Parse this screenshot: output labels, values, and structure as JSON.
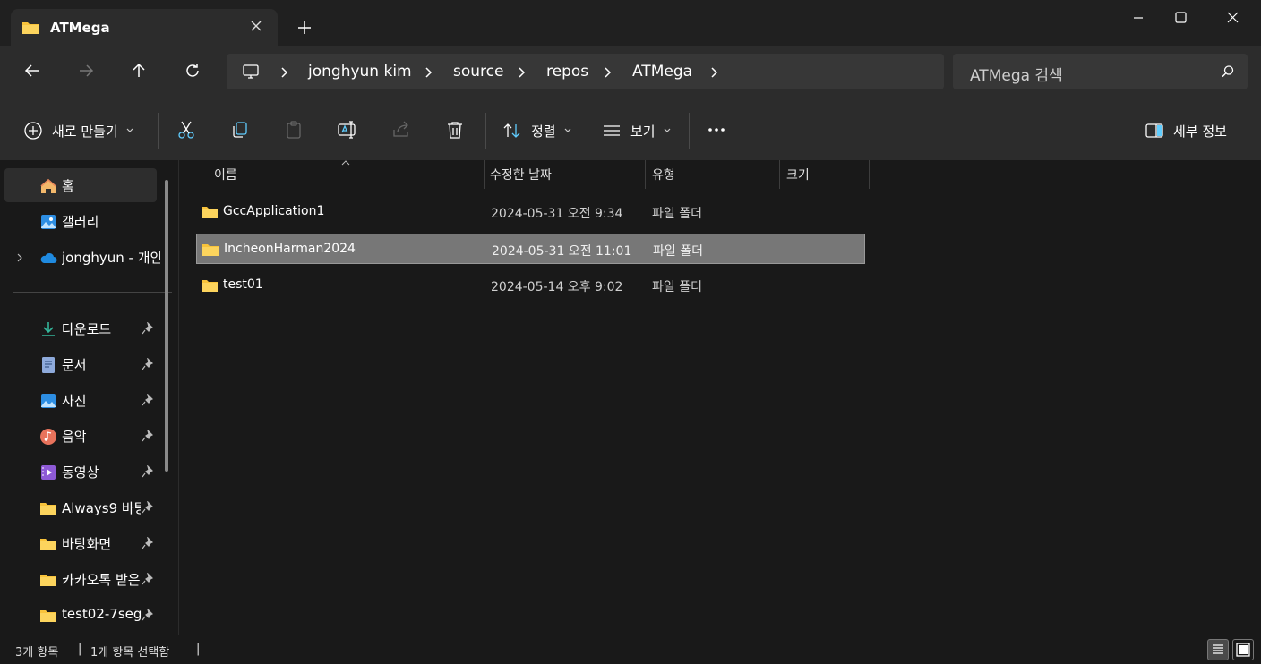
{
  "tab": {
    "title": "ATMega"
  },
  "address": {
    "crumbs": [
      "jonghyun kim",
      "source",
      "repos",
      "ATMega"
    ]
  },
  "search": {
    "placeholder": "ATMega 검색"
  },
  "toolbar": {
    "new_label": "새로 만들기",
    "sort_label": "정렬",
    "view_label": "보기",
    "details_label": "세부 정보"
  },
  "sidebar": {
    "top": [
      {
        "label": "홈",
        "icon": "home-icon"
      },
      {
        "label": "갤러리",
        "icon": "gallery-icon"
      },
      {
        "label": "jonghyun - 개인",
        "icon": "onedrive-icon"
      }
    ],
    "pinned": [
      {
        "label": "다운로드",
        "icon": "download-icon"
      },
      {
        "label": "문서",
        "icon": "document-icon"
      },
      {
        "label": "사진",
        "icon": "pictures-icon"
      },
      {
        "label": "음악",
        "icon": "music-icon"
      },
      {
        "label": "동영상",
        "icon": "video-icon"
      },
      {
        "label": "Always9 바탕",
        "icon": "folder-icon"
      },
      {
        "label": "바탕화면",
        "icon": "folder-icon"
      },
      {
        "label": "카카오톡 받은",
        "icon": "folder-icon"
      },
      {
        "label": "test02-7seg",
        "icon": "folder-icon"
      }
    ]
  },
  "columns": {
    "name": "이름",
    "date": "수정한 날짜",
    "type": "유형",
    "size": "크기"
  },
  "files": [
    {
      "name": "GccApplication1",
      "date": "2024-05-31 오전 9:34",
      "type": "파일 폴더"
    },
    {
      "name": "IncheonHarman2024",
      "date": "2024-05-31 오전 11:01",
      "type": "파일 폴더"
    },
    {
      "name": "test01",
      "date": "2024-05-14 오후 9:02",
      "type": "파일 폴더"
    }
  ],
  "status": {
    "count": "3개 항목",
    "selected": "1개 항목 선택함"
  },
  "colors": {
    "folder": "#f8c33b",
    "selection": "#777777",
    "accent": "#4cc2ff"
  }
}
